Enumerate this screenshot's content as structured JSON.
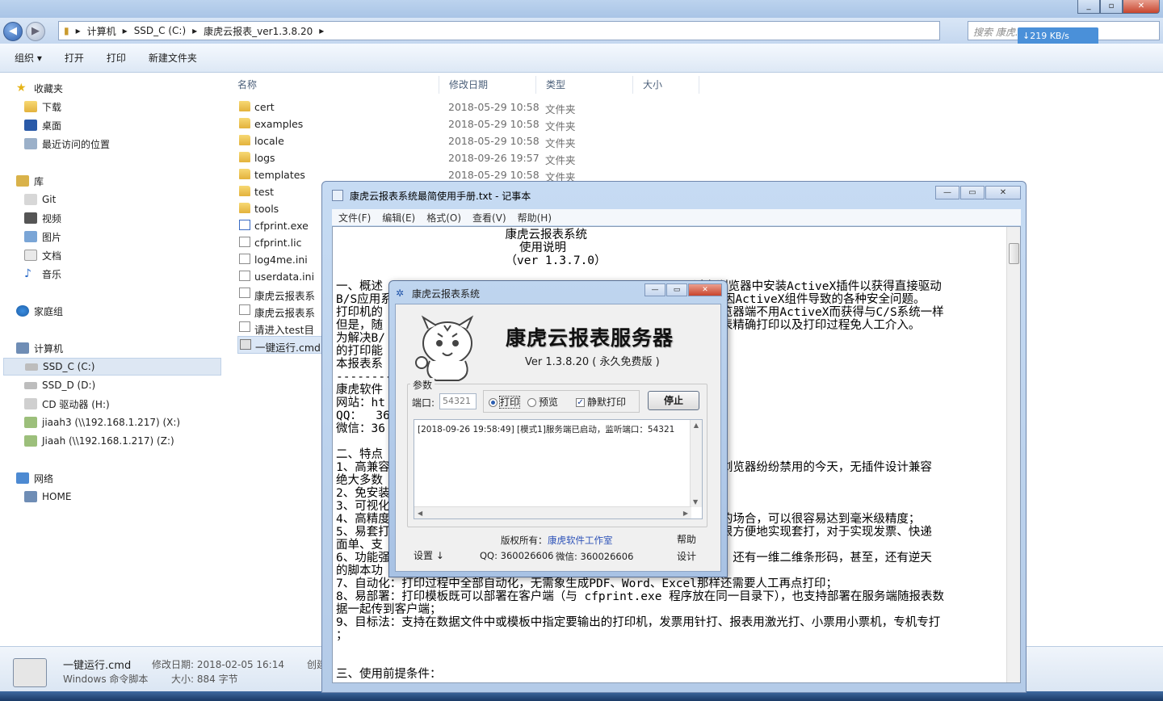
{
  "explorer": {
    "breadcrumb": [
      "计算机",
      "SSD_C (C:)",
      "康虎云报表_ver1.3.8.20"
    ],
    "search_placeholder": "搜索 康虎...",
    "net_speed": "↓219 KB/s",
    "toolbar": {
      "organize": "组织 ▾",
      "open": "打开",
      "print": "打印",
      "new_folder": "新建文件夹"
    },
    "nav": {
      "favorites": "收藏夹",
      "downloads": "下载",
      "desktop": "桌面",
      "recent": "最近访问的位置",
      "libraries": "库",
      "git": "Git",
      "video": "视频",
      "pictures": "图片",
      "docs": "文档",
      "music": "音乐",
      "homegroup": "家庭组",
      "computer": "计算机",
      "ssd_c": "SSD_C (C:)",
      "ssd_d": "SSD_D (D:)",
      "cd": "CD 驱动器 (H:)",
      "jiaah3": "jiaah3 (\\\\192.168.1.217) (X:)",
      "jiaah": "Jiaah (\\\\192.168.1.217) (Z:)",
      "network": "网络",
      "home": "HOME"
    },
    "columns": {
      "name": "名称",
      "date": "修改日期",
      "type": "类型",
      "size": "大小"
    },
    "files": [
      {
        "name": "cert",
        "date": "2018-05-29 10:58",
        "type": "文件夹"
      },
      {
        "name": "examples",
        "date": "2018-05-29 10:58",
        "type": "文件夹"
      },
      {
        "name": "locale",
        "date": "2018-05-29 10:58",
        "type": "文件夹"
      },
      {
        "name": "logs",
        "date": "2018-09-26 19:57",
        "type": "文件夹"
      },
      {
        "name": "templates",
        "date": "2018-05-29 10:58",
        "type": "文件夹"
      },
      {
        "name": "test",
        "date": "",
        "type": ""
      },
      {
        "name": "tools",
        "date": "",
        "type": ""
      },
      {
        "name": "cfprint.exe",
        "date": "",
        "type": ""
      },
      {
        "name": "cfprint.lic",
        "date": "",
        "type": ""
      },
      {
        "name": "log4me.ini",
        "date": "",
        "type": ""
      },
      {
        "name": "userdata.ini",
        "date": "",
        "type": ""
      },
      {
        "name": "康虎云报表系统",
        "date": "",
        "type": ""
      },
      {
        "name": "康虎云报表系统",
        "date": "",
        "type": ""
      },
      {
        "name": "请进入test目录",
        "date": "",
        "type": ""
      },
      {
        "name": "一键运行.cmd",
        "date": "",
        "type": ""
      }
    ],
    "status": {
      "filename": "一键运行.cmd",
      "modified_label": "修改日期: 2018-02-05 16:14",
      "created_label": "创建",
      "filetype": "Windows 命令脚本",
      "size_label": "大小: 884 字节"
    }
  },
  "notepad": {
    "title": "康虎云报表系统最简使用手册.txt - 记事本",
    "menu": [
      "文件(F)",
      "编辑(E)",
      "格式(O)",
      "查看(V)",
      "帮助(H)"
    ],
    "lines": [
      "                        康虎云报表系统",
      "                          使用说明",
      "                        （ver 1.3.7.0）",
      "",
      "一、概述                                            过在浏览器中安装ActiveX插件以获得直接驱动",
      "B/S应用系                                          以避免因ActiveX组件导致的各种安全问题。",
      "打印机的                                           了在浏览器端不用ActiveX而获得与C/S系统一样",
      "但是，随                                           实现报表精确打印以及打印过程免人工介入。",
      "为解决B/",
      "的打印能",
      "本报表系",
      "----------",
      "康虎软件",
      "网站：ht",
      "QQ：  36",
      "微信：36",
      "",
      "二、特点",
      "1、高兼容                                          被各大浏览器纷纷禁用的今天，无插件设计兼容",
      "绝大多数",
      "2、免安装                                          久弥新；",
      "3、可视化",
      "4、高精度                                          确打印的场合，可以很容易达到毫米级精度；",
      "5、易套打                                          ，可以很方便地实现套打，对于实现发票、快递",
      "面单、支",
      "6、功能强                                          松应对。还有一维二维条形码，甚至，还有逆天",
      "的脚本功",
      "7、自动化：打印过程中全部自动化，无需象生成PDF、Word、Excel那样还需要人工再点打印；",
      "8、易部署：打印模板既可以部署在客户端（与 cfprint.exe 程序放在同一目录下），也支持部署在服务端随报表数",
      "据一起传到客户端；",
      "9、目标法：支持在数据文件中或模板中指定要输出的打印机，发票用针打、报表用激光打、小票用小票机，专机专打",
      "；",
      "",
      "",
      "三、使用前提条件："
    ]
  },
  "dialog": {
    "title": "康虎云报表系统",
    "heading": "康虎云报表服务器",
    "version": "Ver 1.3.8.20 ( 永久免费版 )",
    "group_label": "参数",
    "port_label": "端口:",
    "port_value": "54321",
    "opt_print": "打印",
    "opt_preview": "预览",
    "opt_silent": "静默打印",
    "stop_button": "停止",
    "log": "[2018-09-26 19:58:49] [模式1]服务端已启动，监听端口：54321",
    "copyright_label": "版权所有：",
    "copyright_link": "康虎软件工作室",
    "qq": "QQ:  360026606",
    "wechat": "微信: 360026606",
    "settings": "设置 ↓",
    "help": "帮助",
    "design": "设计"
  }
}
